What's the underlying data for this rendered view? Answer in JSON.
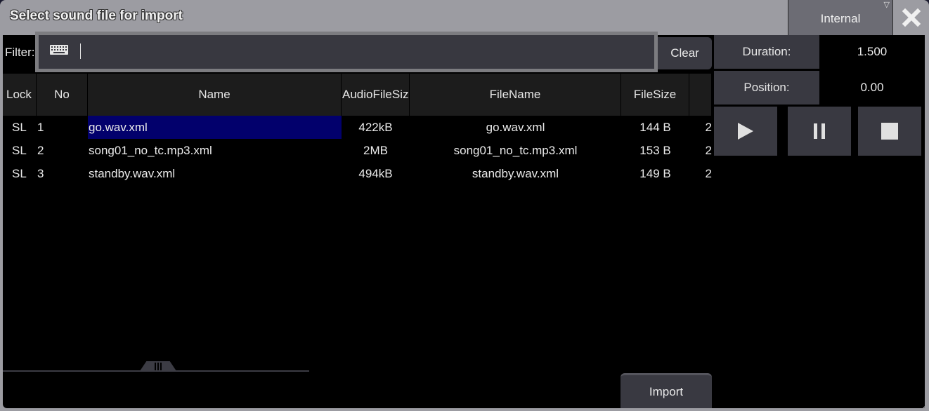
{
  "window": {
    "title": "Select sound file for import"
  },
  "source_dropdown": {
    "value": "Internal",
    "arrow_icon": "triangle-down-icon"
  },
  "close": {
    "icon": "close-x-icon"
  },
  "filter": {
    "label": "Filter:",
    "value": "",
    "keyboard_icon": "keyboard-icon",
    "clear_label": "Clear"
  },
  "table": {
    "columns": [
      "Lock",
      "No",
      "Name",
      "AudioFileSiz",
      "FileName",
      "FileSize",
      ""
    ],
    "rows": [
      {
        "lock": "SL",
        "no": "1",
        "name": "go.wav.xml",
        "audio_size": "422kB",
        "file_name": "go.wav.xml",
        "file_size": "144 B",
        "extra": "2",
        "selected": true
      },
      {
        "lock": "SL",
        "no": "2",
        "name": "song01_no_tc.mp3.xml",
        "audio_size": "2MB",
        "file_name": "song01_no_tc.mp3.xml",
        "file_size": "153 B",
        "extra": "2",
        "selected": false
      },
      {
        "lock": "SL",
        "no": "3",
        "name": "standby.wav.xml",
        "audio_size": "494kB",
        "file_name": "standby.wav.xml",
        "file_size": "149 B",
        "extra": "2",
        "selected": false
      }
    ]
  },
  "playback": {
    "duration_label": "Duration:",
    "duration_value": "1.500",
    "position_label": "Position:",
    "position_value": "0.00",
    "buttons": [
      "play-icon",
      "pause-icon",
      "stop-icon"
    ]
  },
  "import_label": "Import",
  "colors": {
    "selection": "#02006c",
    "panel": "#393941",
    "frame": "#9c9ca2"
  }
}
